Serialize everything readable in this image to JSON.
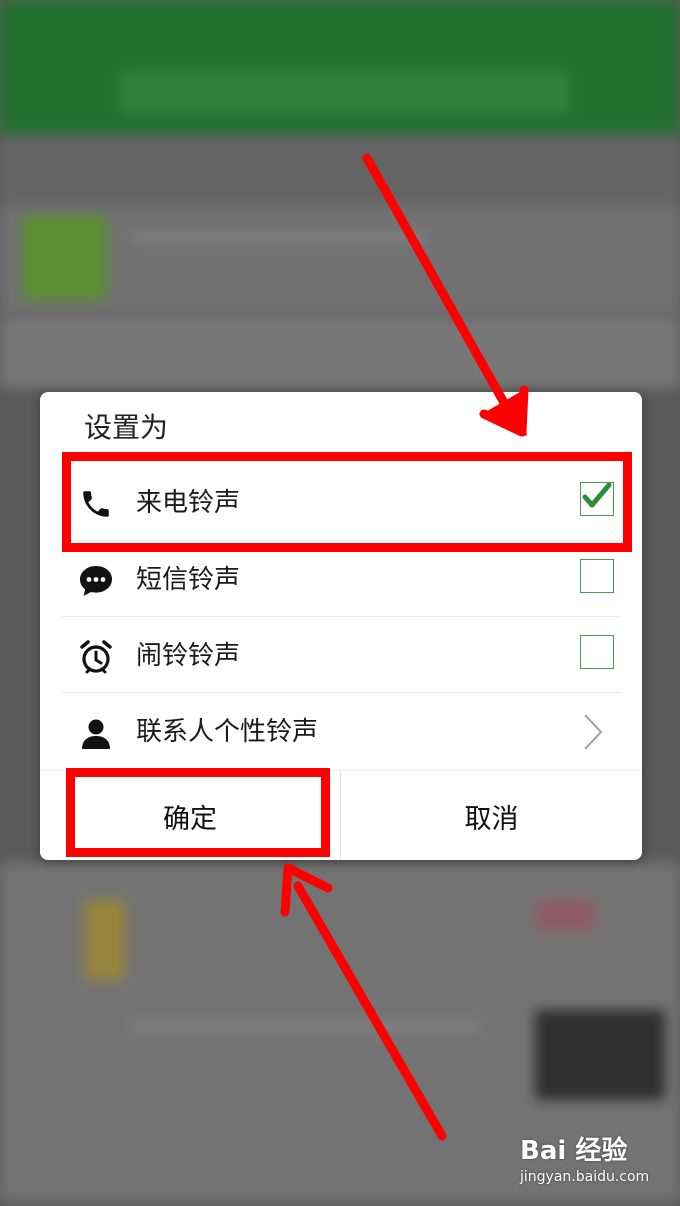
{
  "dialog": {
    "title": "设置为",
    "options": [
      {
        "label": "来电铃声",
        "icon": "phone-icon",
        "checked": true
      },
      {
        "label": "短信铃声",
        "icon": "message-icon",
        "checked": false
      },
      {
        "label": "闹铃铃声",
        "icon": "alarm-clock-icon",
        "checked": false
      },
      {
        "label": "联系人个性铃声",
        "icon": "person-icon"
      }
    ],
    "confirm_label": "确定",
    "cancel_label": "取消"
  },
  "watermark": {
    "logo": "Bai 经验",
    "url": "jingyan.baidu.com"
  },
  "colors": {
    "highlight": "#ff0000",
    "check": "#2e8b3a",
    "checkbox_border": "#4a9a55"
  }
}
